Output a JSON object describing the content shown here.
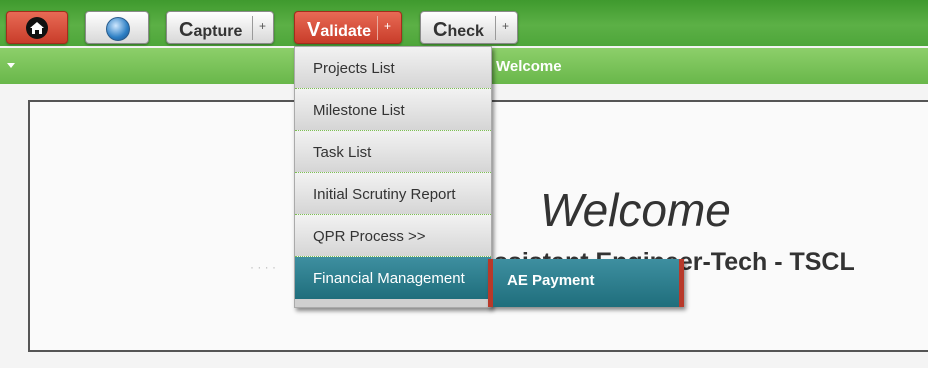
{
  "toolbar": {
    "capture_first": "C",
    "capture_rest": "apture",
    "validate_first": "V",
    "validate_rest": "alidate",
    "check_first": "C",
    "check_rest": "heck",
    "plus": "+"
  },
  "subbar": {
    "title": "Welcome"
  },
  "dropdown": {
    "items": [
      "Projects List",
      "Milestone List",
      "Task List",
      "Initial Scrutiny Report",
      "QPR Process  >>",
      "Financial Management"
    ]
  },
  "submenu": {
    "label": "AE Payment"
  },
  "main": {
    "welcome": "Welcome",
    "role": "Assistant Engineer-Tech - TSCL"
  },
  "colors": {
    "bar": "#5cb046",
    "active": "#1f6e7c",
    "accent_red": "#c83d2a"
  },
  "icons": [
    "home-icon",
    "globe-icon",
    "plus-icon",
    "caret-down-icon"
  ]
}
